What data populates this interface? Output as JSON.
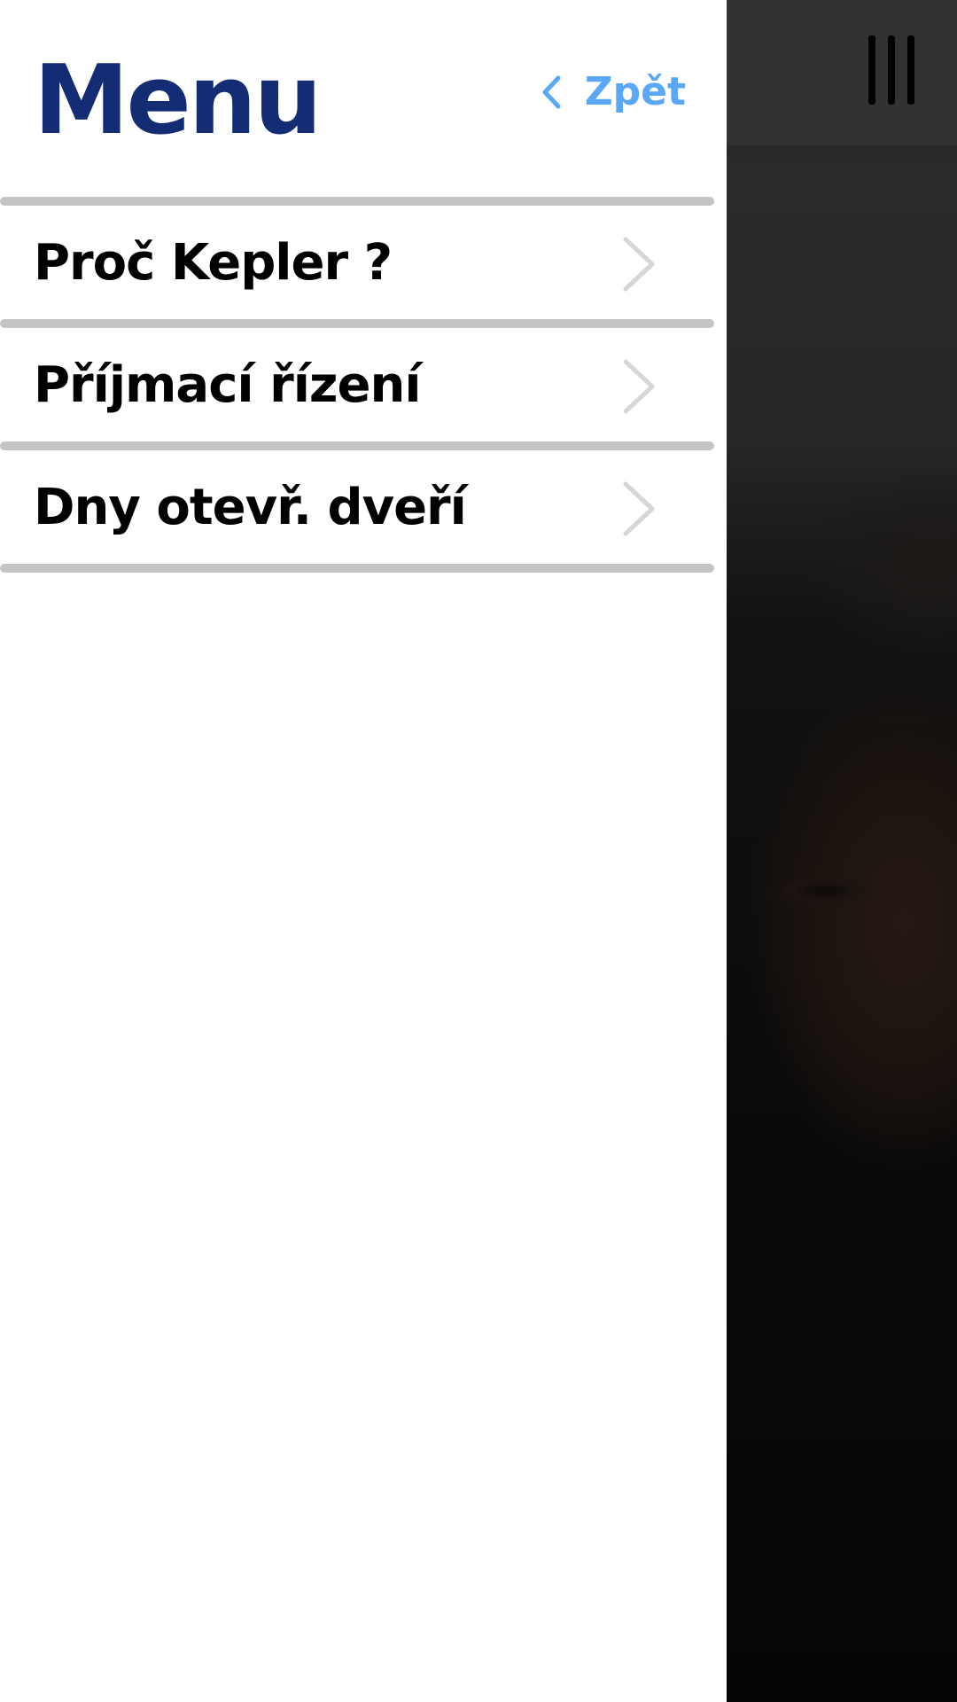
{
  "drawer": {
    "title": "Menu",
    "back_label": "Zpět",
    "items": [
      {
        "label": "Proč Kepler ?",
        "icon": "chevron-right-icon"
      },
      {
        "label": "Příjmací řízení",
        "icon": "chevron-right-icon"
      },
      {
        "label": "Dny otevř. dveří",
        "icon": "chevron-right-icon"
      }
    ]
  },
  "colors": {
    "title": "#142c73",
    "back_link": "#5aa8f5",
    "divider": "#c4c4c4",
    "chevron": "#d6d6d6",
    "topbar": "#323232"
  },
  "background": {
    "menu_icon": "hamburger-icon"
  }
}
